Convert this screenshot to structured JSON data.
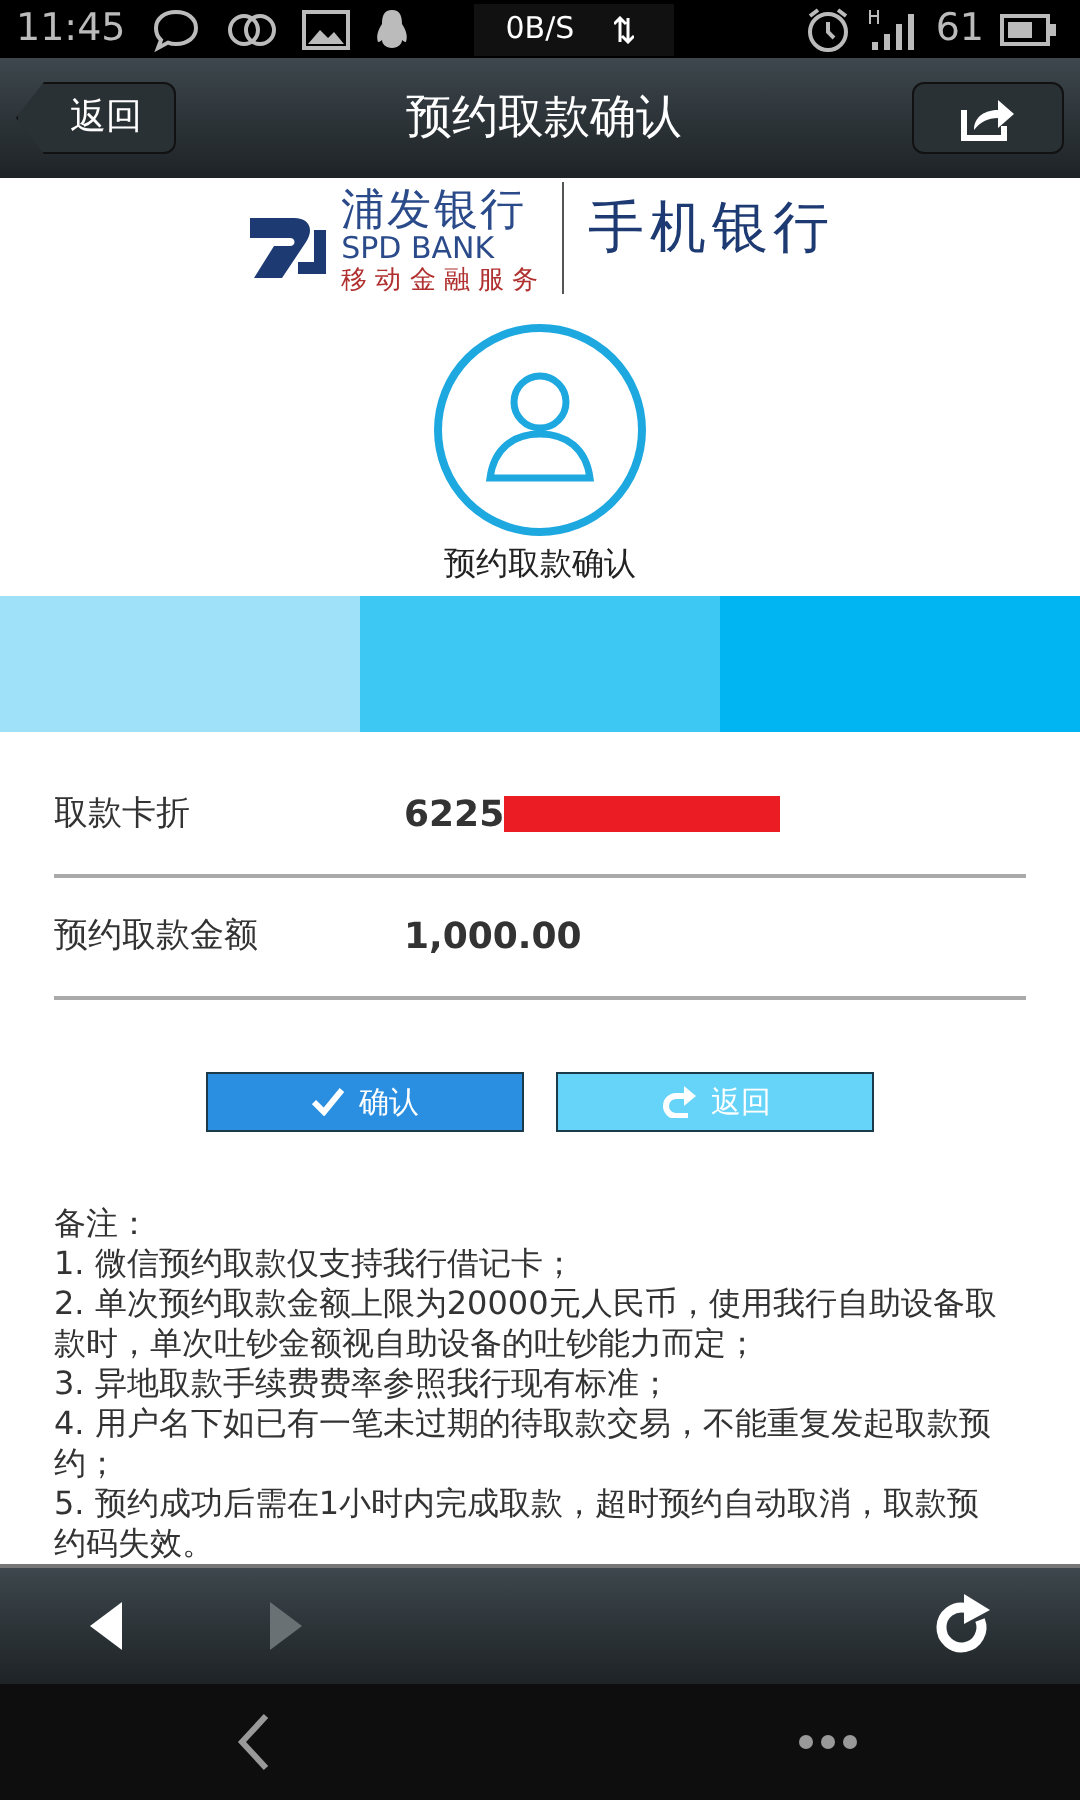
{
  "status_bar": {
    "time": "11:45",
    "net_speed": "0B/S",
    "battery": "61"
  },
  "header": {
    "back": "返回",
    "title": "预约取款确认"
  },
  "brand": {
    "name": "浦发银行",
    "name_en": "SPD BANK",
    "slogan": "移 动 金 融 服 务",
    "app": "手机银行"
  },
  "step": {
    "label": "预约取款确认"
  },
  "fields": [
    {
      "label": "取款卡折",
      "value": "6225",
      "redacted": true
    },
    {
      "label": "预约取款金额",
      "value": "1,000.00",
      "redacted": false
    }
  ],
  "buttons": [
    {
      "kind": "confirm",
      "label": "确认"
    },
    {
      "kind": "back",
      "label": "返回"
    }
  ],
  "notes": {
    "title": "备注：",
    "items": [
      "1. 微信预约取款仅支持我行借记卡；",
      "2. 单次预约取款金额上限为20000元人民币，使用我行自助设备取款时，单次吐钞金额视自助设备的吐钞能力而定；",
      "3. 异地取款手续费费率参照我行现有标准；",
      "4. 用户名下如已有一笔未过期的待取款交易，不能重复发起取款预约；",
      "5. 预约成功后需在1小时内完成取款，超时预约自动取消，取款预约码失效。"
    ]
  },
  "toolbar": {
    "forward_disabled": true
  }
}
